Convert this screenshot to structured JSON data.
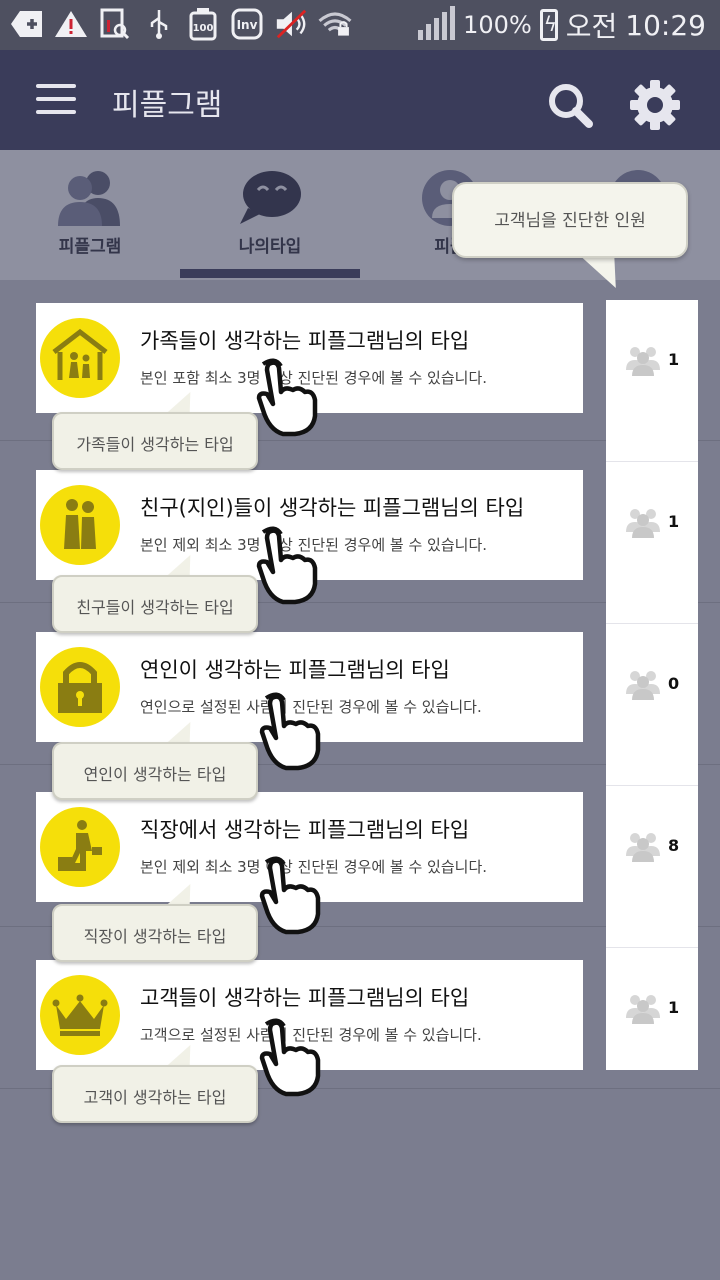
{
  "status_bar": {
    "battery": "100%",
    "ampm": "오전",
    "time": "10:29"
  },
  "header": {
    "title": "피플그램"
  },
  "tabs": [
    {
      "label": "피플그램",
      "icon": "people-icon"
    },
    {
      "label": "나의타입",
      "icon": "chat-bubble-icon",
      "selected": true
    },
    {
      "label": "피플",
      "icon": "person-circle-icon"
    }
  ],
  "tooltip": {
    "text": "고객님을 진단한 인원"
  },
  "items": [
    {
      "title": "가족들이 생각하는  피플그램님의 타입",
      "desc": "본인 포함 최소 3명 이상 진단된 경우에 볼 수 있습니다.",
      "bubble": "가족들이 생각하는 타입",
      "count": "1",
      "icon": "house-family-icon"
    },
    {
      "title": "친구(지인)들이 생각하는 피플그램님의 타입",
      "desc": "본인 제외 최소 3명 이상 진단된 경우에 볼 수 있습니다.",
      "bubble": "친구들이 생각하는 타입",
      "count": "1",
      "icon": "friends-icon"
    },
    {
      "title": "연인이 생각하는 피플그램님의 타입",
      "desc": "연인으로 설정된 사람이 진단된 경우에 볼 수 있습니다.",
      "bubble": "연인이 생각하는 타입",
      "count": "0",
      "icon": "lock-icon"
    },
    {
      "title": "직장에서 생각하는 피플그램님의 타입",
      "desc": "본인 제외 최소 3명 이상 진단된 경우에 볼 수 있습니다.",
      "bubble": "직장이 생각하는 타입",
      "count": "8",
      "icon": "office-worker-icon"
    },
    {
      "title": "고객들이 생각하는 피플그램님의 타입",
      "desc": "고객으로 설정된 사람이 진단된 경우에 볼 수 있습니다.",
      "bubble": "고객이 생각하는 타입",
      "count": "1",
      "icon": "crown-icon"
    }
  ],
  "colors": {
    "header": "#3a3c5a",
    "tab_bar": "#8e90a0",
    "background": "#7b7d8f",
    "icon_yellow": "#f5df0a",
    "icon_mark": "#8a7d12"
  }
}
